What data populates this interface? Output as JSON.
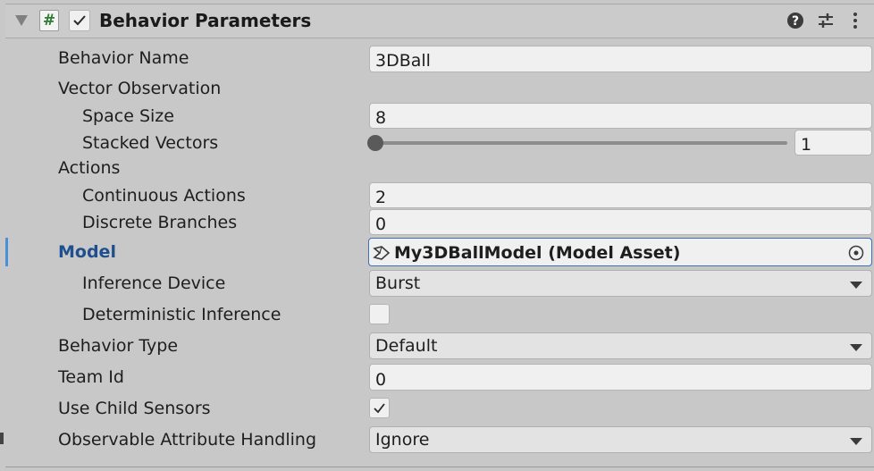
{
  "header": {
    "title": "Behavior Parameters",
    "script_glyph": "#",
    "enabled": true
  },
  "colors": {
    "accent": "#1f4f8f",
    "panel_bg": "#c8c8c8",
    "field_bg": "#f0f0f0"
  },
  "fields": {
    "behavior_name": {
      "label": "Behavior Name",
      "value": "3DBall"
    },
    "vector_observation": {
      "label": "Vector Observation"
    },
    "space_size": {
      "label": "Space Size",
      "value": "8"
    },
    "stacked_vectors": {
      "label": "Stacked Vectors",
      "value": "1",
      "slider_fraction": 0
    },
    "actions": {
      "label": "Actions"
    },
    "continuous_actions": {
      "label": "Continuous Actions",
      "value": "2"
    },
    "discrete_branches": {
      "label": "Discrete Branches",
      "value": "0"
    },
    "model": {
      "label": "Model",
      "value": "My3DBallModel (Model Asset)"
    },
    "inference_device": {
      "label": "Inference Device",
      "value": "Burst"
    },
    "deterministic_inference": {
      "label": "Deterministic Inference",
      "checked": false
    },
    "behavior_type": {
      "label": "Behavior Type",
      "value": "Default"
    },
    "team_id": {
      "label": "Team Id",
      "value": "0"
    },
    "use_child_sensors": {
      "label": "Use Child Sensors",
      "checked": true
    },
    "observable_attribute_handling": {
      "label": "Observable Attribute Handling",
      "value": "Ignore"
    }
  },
  "icons": [
    "collapse-triangle-icon",
    "script-icon",
    "help-icon",
    "preset-sliders-icon",
    "more-vert-icon",
    "model-asset-icon",
    "object-picker-icon",
    "dropdown-arrow-icon",
    "checkmark-icon"
  ]
}
